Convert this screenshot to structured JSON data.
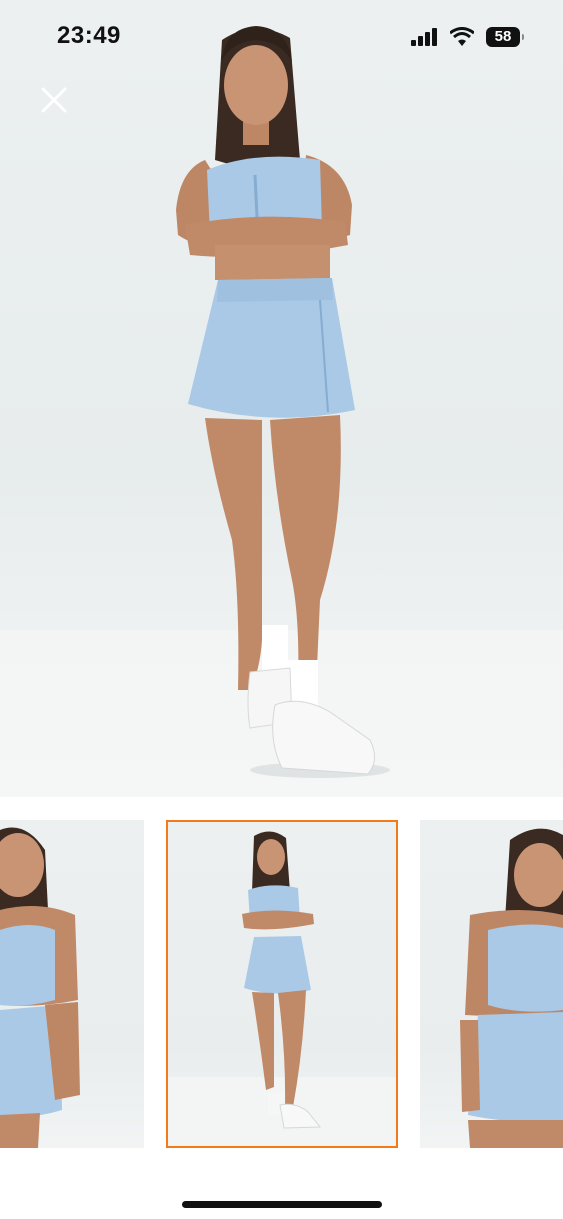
{
  "status_bar": {
    "time": "23:49",
    "battery_level": "58",
    "signal_icon": "cellular-signal-icon",
    "wifi_icon": "wifi-icon",
    "battery_icon": "battery-icon"
  },
  "viewer": {
    "close_icon": "close-icon",
    "main_image": "product-photo-model-denim-crop-top-and-skort",
    "thumbnails": [
      {
        "name": "thumbnail-1",
        "selected": false
      },
      {
        "name": "thumbnail-2",
        "selected": true
      },
      {
        "name": "thumbnail-3",
        "selected": false
      }
    ],
    "selected_border_color": "#f27a1a"
  },
  "colors": {
    "denim": "#a9c9e6",
    "denim_dark": "#86acd2",
    "skin": "#c08a68",
    "background": "#ecf0f0"
  }
}
